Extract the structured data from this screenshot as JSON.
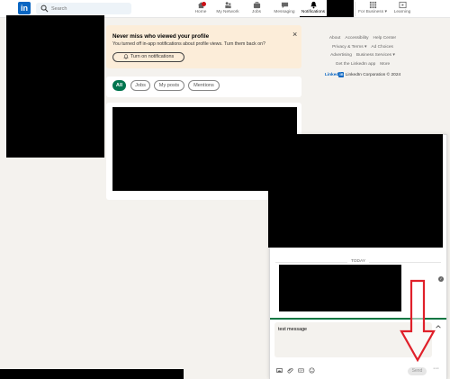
{
  "nav": {
    "logo": "in",
    "search_placeholder": "Search",
    "items": [
      {
        "label": "Home",
        "icon": "home-icon"
      },
      {
        "label": "My Network",
        "icon": "network-icon"
      },
      {
        "label": "Jobs",
        "icon": "briefcase-icon"
      },
      {
        "label": "Messaging",
        "icon": "messaging-icon"
      },
      {
        "label": "Notifications",
        "icon": "bell-icon",
        "active": true
      },
      {
        "label": "For Business",
        "icon": "grid-icon",
        "has_dropdown": true
      },
      {
        "label": "Learning",
        "icon": "play-icon"
      }
    ],
    "dropdown_caret": "▾"
  },
  "promo": {
    "title": "Never miss who viewed your profile",
    "subtitle": "You turned off in-app notifications about profile views. Turn them back on?",
    "button": "Turn on notifications",
    "close": "×"
  },
  "filters": [
    "All",
    "Jobs",
    "My posts",
    "Mentions"
  ],
  "footer": {
    "row1": [
      "About",
      "Accessibility",
      "Help Center"
    ],
    "row2": [
      "Privacy & Terms ▾",
      "Ad Choices"
    ],
    "row3": [
      "Advertising",
      "Business Services ▾"
    ],
    "row4": [
      "Get the LinkedIn app",
      "More"
    ],
    "brand_word": "Linked",
    "brand_box": "in",
    "copyright": "LinkedIn Corporation © 2024"
  },
  "messaging": {
    "day_label": "TODAY",
    "compose_value": "test message",
    "send_label": "Send",
    "more_label": "···"
  },
  "colors": {
    "brand": "#0a66c2",
    "active_pill": "#01754f",
    "promo_bg": "#fcedd9",
    "annotation_arrow": "#e0202a",
    "compose_divider": "#057642"
  }
}
